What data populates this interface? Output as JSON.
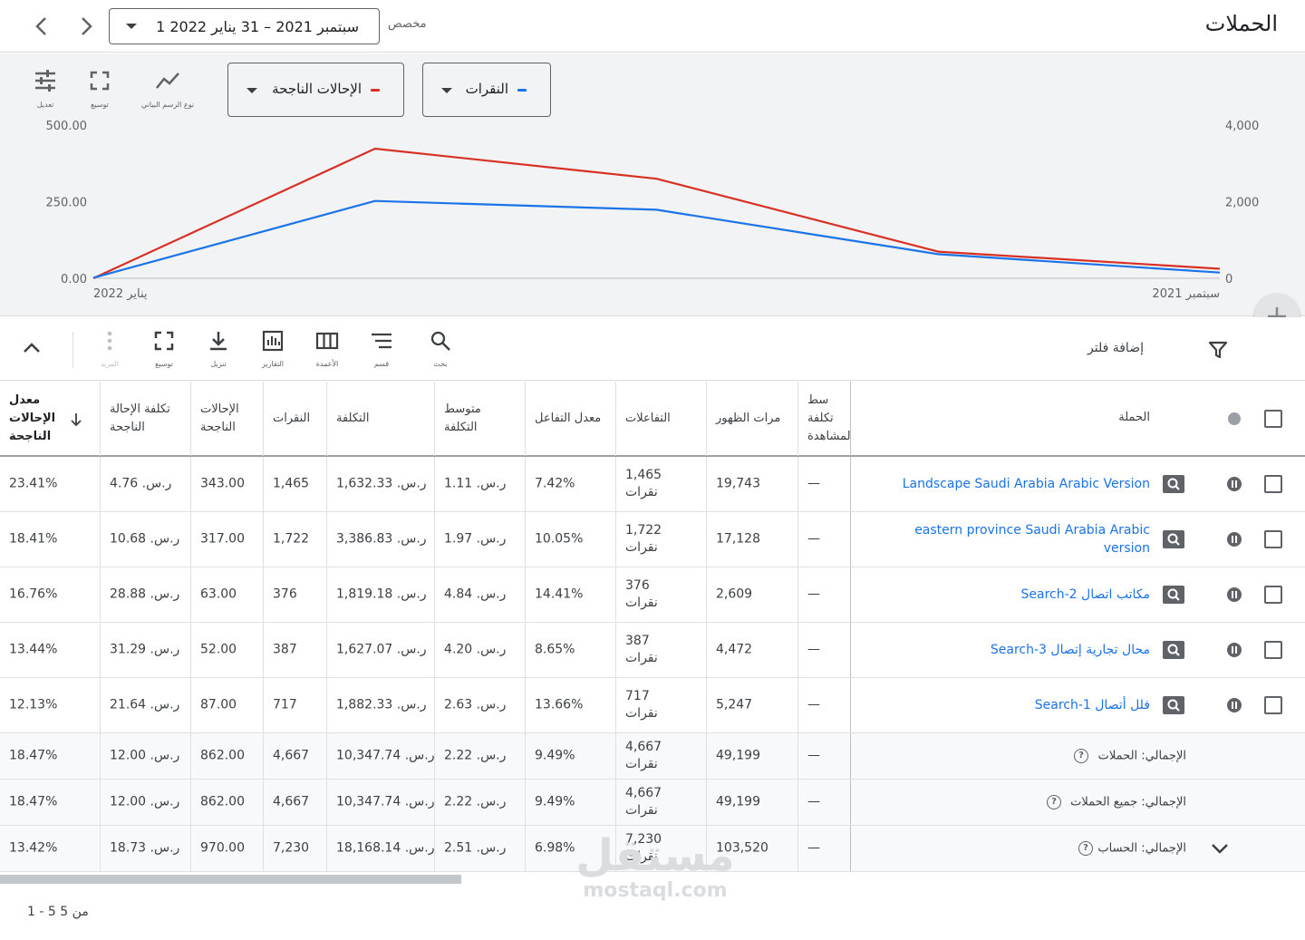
{
  "header": {
    "title": "الحملات",
    "date_range": "1 سبتمبر 2021 – 31 يناير 2022",
    "date_mode": "مخصص"
  },
  "chart_controls": {
    "metric1": {
      "label": "النقرات",
      "color": "#1a73e8"
    },
    "metric2": {
      "label": "الإحالات الناجحة",
      "color": "#d93025"
    },
    "tools": [
      {
        "name": "chart-type",
        "label": "نوع الرسم البياني",
        "icon": "line-chart-icon"
      },
      {
        "name": "expand",
        "label": "توسيع",
        "icon": "expand-icon"
      },
      {
        "name": "adjust",
        "label": "تعديل",
        "icon": "tune-icon"
      }
    ]
  },
  "chart_data": {
    "type": "line",
    "x_start_label": "سبتمبر 2021",
    "x_end_label": "يناير 2022",
    "points_count": 5,
    "series": [
      {
        "name": "النقرات",
        "axis": "right",
        "color": "#1a73e8",
        "values": [
          150,
          630,
          1790,
          2020,
          15
        ]
      },
      {
        "name": "الإحالات الناجحة",
        "axis": "left",
        "color": "#d93025",
        "values": [
          31,
          87,
          325,
          423,
          0
        ]
      }
    ],
    "left_axis": {
      "ticks": [
        "500.00",
        "250.00",
        "0.00"
      ],
      "range": [
        0,
        500
      ]
    },
    "right_axis": {
      "ticks": [
        "4,000",
        "2,000",
        "0"
      ],
      "range": [
        0,
        4000
      ]
    }
  },
  "toolbar": {
    "filter_label": "إضافة فلتر",
    "buttons": [
      {
        "name": "search",
        "label": "بحث"
      },
      {
        "name": "segment",
        "label": "قسم"
      },
      {
        "name": "columns",
        "label": "الأعمدة"
      },
      {
        "name": "reports",
        "label": "التقارير"
      },
      {
        "name": "download",
        "label": "تنزيل"
      },
      {
        "name": "expand",
        "label": "توسيع"
      },
      {
        "name": "more",
        "label": "المزيد"
      }
    ]
  },
  "table": {
    "headers": {
      "campaign": "الحملة",
      "avg_cpv": "سط تكلفة المشاهدة",
      "impressions": "مرات الظهور",
      "interactions": "التفاعلات",
      "interaction_rate": "معدل التفاعل",
      "avg_cost": "متوسط التكلفة",
      "cost": "التكلفة",
      "clicks": "النقرات",
      "conversions": "الإحالات الناجحة",
      "cost_per_conv": "تكلفة الإحالة الناجحة",
      "conv_rate": "معدل الإحالات الناجحة"
    },
    "rows": [
      {
        "campaign": "Landscape Saudi Arabia Arabic Version",
        "avg_cpv": "—",
        "impressions": "19,743",
        "interactions": "1,465",
        "interactions_unit": "نقرات",
        "interaction_rate": "7.42%",
        "avg_cost": "ر.س. 1.11",
        "cost": "ر.س. 1,632.33",
        "clicks": "1,465",
        "conversions": "343.00",
        "cost_per_conv": "ر.س. 4.76",
        "conv_rate": "23.41%"
      },
      {
        "campaign": "eastern province Saudi Arabia Arabic version",
        "avg_cpv": "—",
        "impressions": "17,128",
        "interactions": "1,722",
        "interactions_unit": "نقرات",
        "interaction_rate": "10.05%",
        "avg_cost": "ر.س. 1.97",
        "cost": "ر.س. 3,386.83",
        "clicks": "1,722",
        "conversions": "317.00",
        "cost_per_conv": "ر.س. 10.68",
        "conv_rate": "18.41%"
      },
      {
        "campaign": "Search-2 مكاتب اتصال",
        "avg_cpv": "—",
        "impressions": "2,609",
        "interactions": "376",
        "interactions_unit": "نقرات",
        "interaction_rate": "14.41%",
        "avg_cost": "ر.س. 4.84",
        "cost": "ر.س. 1,819.18",
        "clicks": "376",
        "conversions": "63.00",
        "cost_per_conv": "ر.س. 28.88",
        "conv_rate": "16.76%"
      },
      {
        "campaign": "Search-3 محال تجارية إتصال",
        "avg_cpv": "—",
        "impressions": "4,472",
        "interactions": "387",
        "interactions_unit": "نقرات",
        "interaction_rate": "8.65%",
        "avg_cost": "ر.س. 4.20",
        "cost": "ر.س. 1,627.07",
        "clicks": "387",
        "conversions": "52.00",
        "cost_per_conv": "ر.س. 31.29",
        "conv_rate": "13.44%"
      },
      {
        "campaign": "Search-1 فلل أتصال",
        "avg_cpv": "—",
        "impressions": "5,247",
        "interactions": "717",
        "interactions_unit": "نقرات",
        "interaction_rate": "13.66%",
        "avg_cost": "ر.س. 2.63",
        "cost": "ر.س. 1,882.33",
        "clicks": "717",
        "conversions": "87.00",
        "cost_per_conv": "ر.س. 21.64",
        "conv_rate": "12.13%"
      }
    ],
    "totals": [
      {
        "label": "الإجمالي: الحملات",
        "avg_cpv": "—",
        "impressions": "49,199",
        "interactions": "4,667",
        "interactions_unit": "نقرات",
        "interaction_rate": "9.49%",
        "avg_cost": "ر.س. 2.22",
        "cost": "ر.س. 10,347.74",
        "clicks": "4,667",
        "conversions": "862.00",
        "cost_per_conv": "ر.س. 12.00",
        "conv_rate": "18.47%"
      },
      {
        "label": "الإجمالي: جميع الحملات",
        "avg_cpv": "—",
        "impressions": "49,199",
        "interactions": "4,667",
        "interactions_unit": "نقرات",
        "interaction_rate": "9.49%",
        "avg_cost": "ر.س. 2.22",
        "cost": "ر.س. 10,347.74",
        "clicks": "4,667",
        "conversions": "862.00",
        "cost_per_conv": "ر.س. 12.00",
        "conv_rate": "18.47%"
      },
      {
        "label": "الإجمالي: الحساب",
        "avg_cpv": "—",
        "impressions": "103,520",
        "interactions": "7,230",
        "interactions_unit": "نقرات",
        "interaction_rate": "6.98%",
        "avg_cost": "ر.س. 2.51",
        "cost": "ر.س. 18,168.14",
        "clicks": "7,230",
        "conversions": "970.00",
        "cost_per_conv": "ر.س. 18.73",
        "conv_rate": "13.42%"
      }
    ]
  },
  "pagination": {
    "text": "1 - 5 من 5"
  },
  "watermark": {
    "arabic": "مستقل",
    "latin": "mostaql.com"
  }
}
